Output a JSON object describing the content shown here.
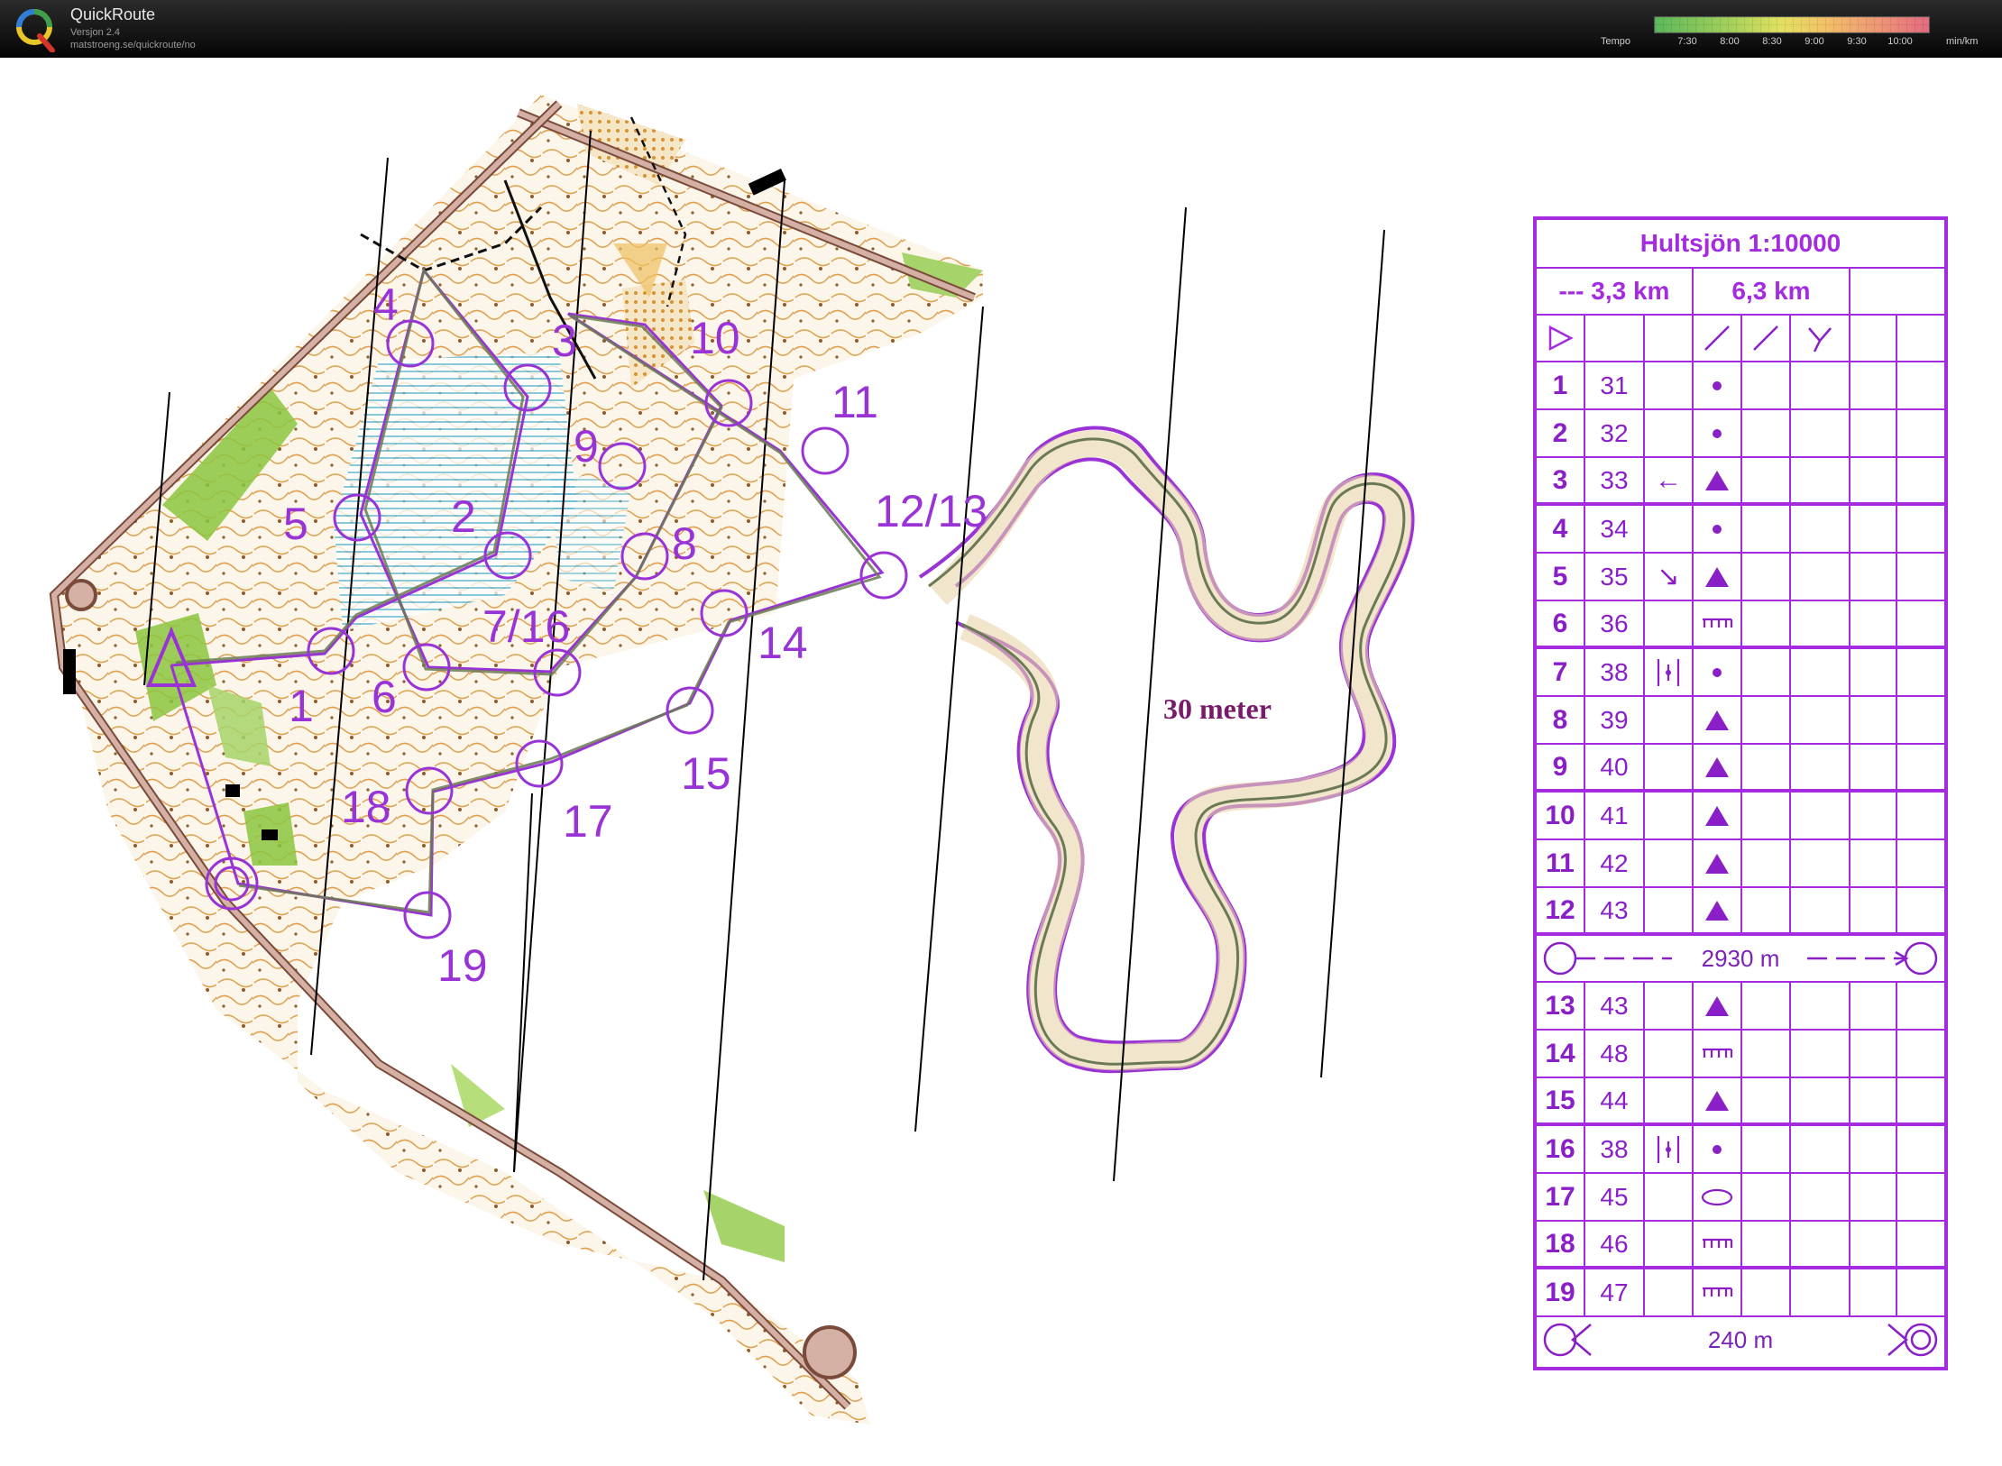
{
  "app": {
    "name": "QuickRoute",
    "version": "Versjon 2.4",
    "url": "matstroeng.se/quickroute/no"
  },
  "tempo_scale": {
    "label": "Tempo",
    "ticks": [
      "7:30",
      "8:00",
      "8:30",
      "9:00",
      "9:30",
      "10:00"
    ],
    "unit": "min/km",
    "colors": [
      "#5cb85c",
      "#e2e160",
      "#e46b80"
    ]
  },
  "map": {
    "scale_note": "30 meter",
    "control_labels": [
      "1",
      "2",
      "3",
      "4",
      "5",
      "6",
      "7/16",
      "8",
      "9",
      "10",
      "11",
      "12/13",
      "14",
      "15",
      "17",
      "18",
      "19"
    ],
    "colors": {
      "course": "#9a33d6",
      "route": "#6b7a55",
      "vegetation": "#8cc63f",
      "contour": "#d98c2b"
    }
  },
  "description_sheet": {
    "title": "Hultsjön 1:10000",
    "distances": {
      "left": "--- 3,3 km",
      "right": "6,3 km"
    },
    "start_symbol": "triangle-icon",
    "header_symbols": [
      "path-icon",
      "path-icon",
      "path-fork-icon"
    ],
    "rows_part1": [
      {
        "n": "1",
        "code": "31",
        "dir": "",
        "feature": "dot"
      },
      {
        "n": "2",
        "code": "32",
        "dir": "",
        "feature": "dot"
      },
      {
        "n": "3",
        "code": "33",
        "dir": "←",
        "feature": "triangle"
      },
      {
        "n": "4",
        "code": "34",
        "dir": "",
        "feature": "dot"
      },
      {
        "n": "5",
        "code": "35",
        "dir": "↘",
        "feature": "triangle"
      },
      {
        "n": "6",
        "code": "36",
        "dir": "",
        "feature": "comb"
      },
      {
        "n": "7",
        "code": "38",
        "dir": "||",
        "feature": "dot"
      },
      {
        "n": "8",
        "code": "39",
        "dir": "",
        "feature": "triangle"
      },
      {
        "n": "9",
        "code": "40",
        "dir": "",
        "feature": "triangle"
      },
      {
        "n": "10",
        "code": "41",
        "dir": "",
        "feature": "triangle"
      },
      {
        "n": "11",
        "code": "42",
        "dir": "",
        "feature": "triangle"
      },
      {
        "n": "12",
        "code": "43",
        "dir": "",
        "feature": "triangle"
      }
    ],
    "mid_distance": "2930 m",
    "rows_part2": [
      {
        "n": "13",
        "code": "43",
        "dir": "",
        "feature": "triangle"
      },
      {
        "n": "14",
        "code": "48",
        "dir": "",
        "feature": "comb"
      },
      {
        "n": "15",
        "code": "44",
        "dir": "",
        "feature": "triangle"
      },
      {
        "n": "16",
        "code": "38",
        "dir": "||",
        "feature": "dot"
      },
      {
        "n": "17",
        "code": "45",
        "dir": "",
        "feature": "oval"
      },
      {
        "n": "18",
        "code": "46",
        "dir": "",
        "feature": "comb"
      },
      {
        "n": "19",
        "code": "47",
        "dir": "",
        "feature": "comb"
      }
    ],
    "finish_distance": "240 m"
  }
}
